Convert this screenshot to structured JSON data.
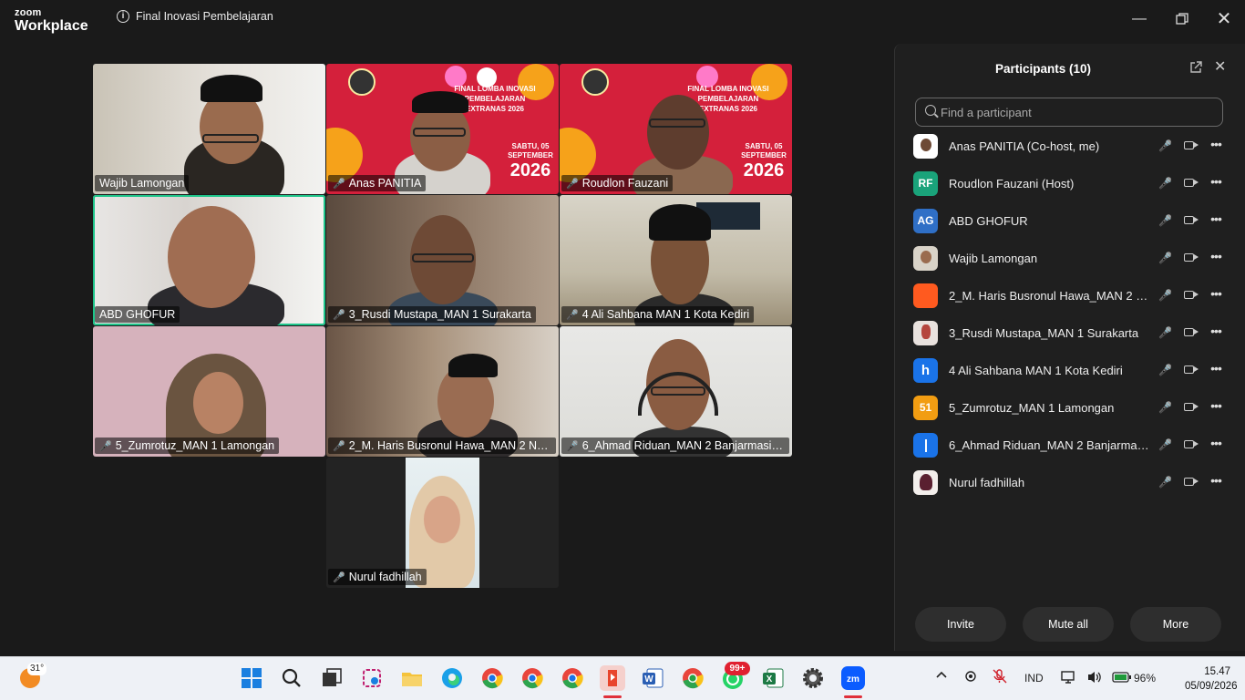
{
  "app": {
    "brand_top": "zoom",
    "brand_bottom": "Workplace",
    "meeting_title": "Final Inovasi Pembelajaran"
  },
  "banner": {
    "line1": "FINAL LOMBA INOVASI",
    "line2": "PEMBELAJARAN",
    "line3": "EXTRANAS 2026",
    "date_line1": "SABTU, 05",
    "date_line2": "SEPTEMBER",
    "year": "2026"
  },
  "tiles": [
    {
      "name": "Wajib Lamongan",
      "muted": false
    },
    {
      "name": "Anas PANITIA",
      "muted": true
    },
    {
      "name": "Roudlon Fauzani",
      "muted": true
    },
    {
      "name": "ABD GHOFUR",
      "muted": false
    },
    {
      "name": "3_Rusdi Mustapa_MAN 1 Surakarta",
      "muted": true
    },
    {
      "name": "4 Ali Sahbana MAN 1 Kota Kediri",
      "muted": true
    },
    {
      "name": "5_Zumrotuz_MAN 1 Lamongan",
      "muted": true
    },
    {
      "name": "2_M. Haris Busronul Hawa_MAN 2 Ng...",
      "muted": true
    },
    {
      "name": "6_Ahmad Riduan_MAN 2 Banjarmasin ...",
      "muted": true
    },
    {
      "name": "Nurul fadhillah",
      "muted": true
    }
  ],
  "participants_panel": {
    "title": "Participants (10)",
    "search_placeholder": "Find a participant",
    "participants": [
      {
        "name": "Anas PANITIA (Co-host, me)",
        "initials": "",
        "avatar_color": "#ffffff",
        "mic": "muted"
      },
      {
        "name": "Roudlon Fauzani (Host)",
        "initials": "RF",
        "avatar_color": "#1aa37a",
        "mic": "muted"
      },
      {
        "name": "ABD GHOFUR",
        "initials": "AG",
        "avatar_color": "#2f6fc6",
        "mic": "on"
      },
      {
        "name": "Wajib Lamongan",
        "initials": "",
        "avatar_color": "#d9d3c8",
        "mic": "on"
      },
      {
        "name": "2_M. Haris Busronul Hawa_MAN 2 N...",
        "initials": "",
        "avatar_color": "#ff5a1f",
        "mic": "muted"
      },
      {
        "name": "3_Rusdi Mustapa_MAN 1 Surakarta",
        "initials": "",
        "avatar_color": "#e9e2de",
        "mic": "muted"
      },
      {
        "name": "4 Ali Sahbana MAN 1 Kota Kediri",
        "initials": "h",
        "avatar_color": "#1a73e8",
        "mic": "muted"
      },
      {
        "name": "5_Zumrotuz_MAN 1 Lamongan",
        "initials": "51",
        "avatar_color": "#f29d12",
        "mic": "muted"
      },
      {
        "name": "6_Ahmad Riduan_MAN 2 Banjarmasi...",
        "initials": "",
        "avatar_color": "#1a73e8",
        "mic": "muted"
      },
      {
        "name": "Nurul fadhillah",
        "initials": "",
        "avatar_color": "#f3efec",
        "mic": "muted"
      }
    ],
    "buttons": {
      "invite": "Invite",
      "mute_all": "Mute all",
      "more": "More"
    }
  },
  "taskbar": {
    "temperature": "31°",
    "notification_badge": "99+",
    "language": "IND",
    "battery": "96%",
    "time": "15.47",
    "date": "05/09/2026"
  }
}
